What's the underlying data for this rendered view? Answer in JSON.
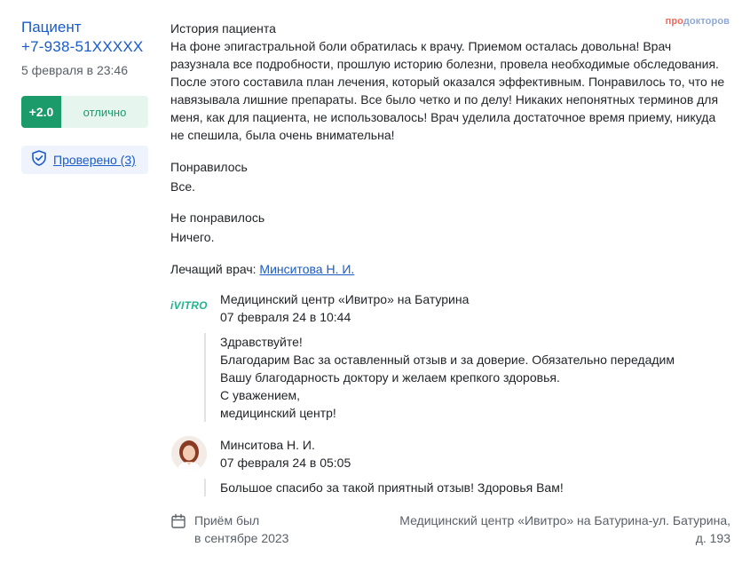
{
  "patient": {
    "name": "Пациент",
    "phone": "+7-938-51XXXXX",
    "date": "5 февраля в 23:46"
  },
  "rating": {
    "score": "+2.0",
    "label": "отлично",
    "score_color": "#1b9a6a"
  },
  "verified": {
    "label": "Проверено (3)",
    "icon": "shield-check-icon"
  },
  "brand": {
    "part1": "про",
    "part2": "докторов"
  },
  "story": {
    "title": "История пациента",
    "text": "На фоне эпигастральной боли обратилась к врачу. Приемом осталась довольна! Врач разузнала все подробности, прошлую историю болезни, провела необходимые обследования. После этого составила план лечения, который оказался эффективным. Понравилось то, что не навязывала лишние препараты. Все было четко и по делу! Никаких непонятных терминов для меня, как для пациента, не использовалось! Врач уделила достаточное время приему, никуда не спешила, была очень внимательна!"
  },
  "liked": {
    "title": "Понравилось",
    "text": "Все."
  },
  "disliked": {
    "title": "Не понравилось",
    "text": "Ничего."
  },
  "doctor": {
    "label": "Лечащий врач:",
    "name": "Минситова Н. И."
  },
  "clinic_reply": {
    "logo": "iVITRO",
    "org": "Медицинский центр «Ивитро» на Батурина",
    "date": "07 февраля 24 в 10:44",
    "lines": [
      "Здравствуйте!",
      "Благодарим Вас за оставленный отзыв и за доверие. Обязательно передадим",
      "Вашу благодарность доктору и желаем крепкого здоровья.",
      "С уважением,",
      "медицинский центр!"
    ]
  },
  "doctor_reply": {
    "name": "Минситова Н. И.",
    "date": "07 февраля 24 в 05:05",
    "text": "Большое спасибо за такой приятный отзыв! Здоровья Вам!"
  },
  "footer": {
    "visit_line1": "Приём был",
    "visit_line2": "в сентябре 2023",
    "address_line1": "Медицинский центр «Ивитро» на Батурина-ул. Батурина,",
    "address_line2": "д. 193"
  }
}
